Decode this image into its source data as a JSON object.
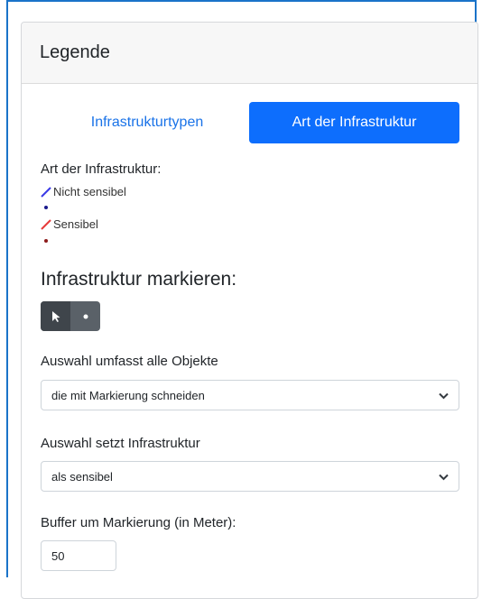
{
  "panel": {
    "title": "Legende"
  },
  "tabs": [
    {
      "label": "Infrastrukturtypen",
      "active": false
    },
    {
      "label": "Art der Infrastruktur",
      "active": true
    }
  ],
  "legend": {
    "heading": "Art der Infrastruktur:",
    "items": [
      {
        "label": "Nicht sensibel",
        "color": "#3a3ae6",
        "dot_color": "#1a1a8c"
      },
      {
        "label": "Sensibel",
        "color": "#e63a3a",
        "dot_color": "#8c1a1a"
      }
    ]
  },
  "marking": {
    "heading": "Infrastruktur markieren:",
    "tools": [
      {
        "icon": "cursor-pointer-icon",
        "active": true
      },
      {
        "icon": "point-icon",
        "active": false
      }
    ]
  },
  "selection_scope": {
    "label": "Auswahl umfasst alle Objekte",
    "value": "die mit Markierung schneiden"
  },
  "selection_sets": {
    "label": "Auswahl setzt Infrastruktur",
    "value": "als sensibel"
  },
  "buffer": {
    "label": "Buffer um Markierung (in Meter):",
    "value": "50"
  },
  "colors": {
    "accent": "#0d6efd",
    "toolbar": "#5a6168"
  }
}
